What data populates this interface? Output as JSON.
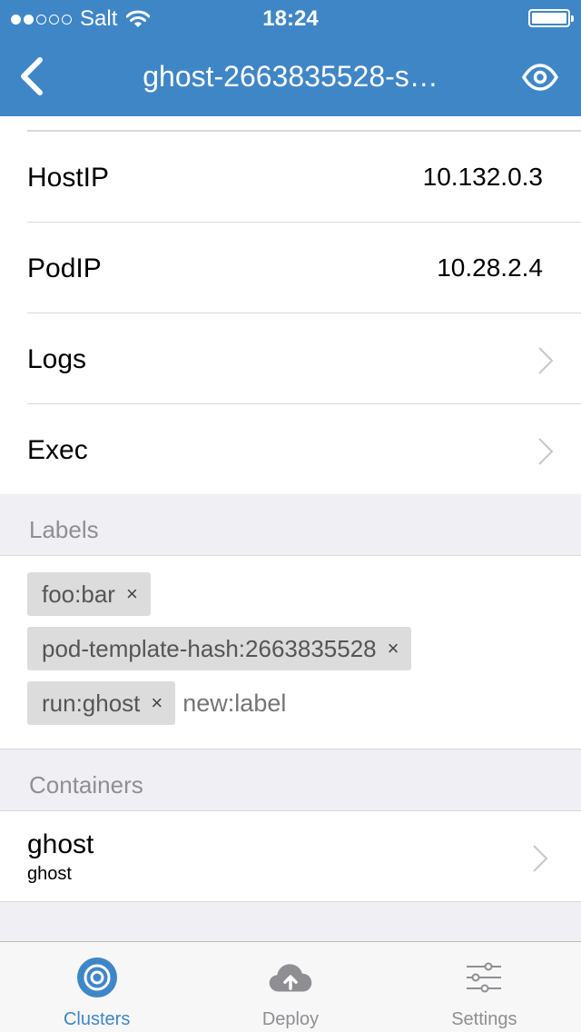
{
  "statusbar": {
    "carrier": "Salt",
    "time": "18:24"
  },
  "nav": {
    "title": "ghost-2663835528-s…"
  },
  "details": [
    {
      "label": "HostIP",
      "value": "10.132.0.3"
    },
    {
      "label": "PodIP",
      "value": "10.28.2.4"
    },
    {
      "label": "Logs"
    },
    {
      "label": "Exec"
    }
  ],
  "labels_section": {
    "header": "Labels",
    "chips": [
      "foo:bar",
      "pod-template-hash:2663835528",
      "run:ghost"
    ],
    "remove_glyph": "×",
    "input_placeholder": "new:label"
  },
  "containers_section": {
    "header": "Containers",
    "items": [
      {
        "name": "ghost",
        "image": "ghost"
      }
    ]
  },
  "tabbar": {
    "tabs": [
      {
        "label": "Clusters",
        "icon": "target-icon",
        "active": true
      },
      {
        "label": "Deploy",
        "icon": "cloud-upload-icon",
        "active": false
      },
      {
        "label": "Settings",
        "icon": "sliders-icon",
        "active": false
      }
    ]
  },
  "colors": {
    "accent": "#3f86c7",
    "background": "#efeff4",
    "chip": "#dcdcdc"
  }
}
